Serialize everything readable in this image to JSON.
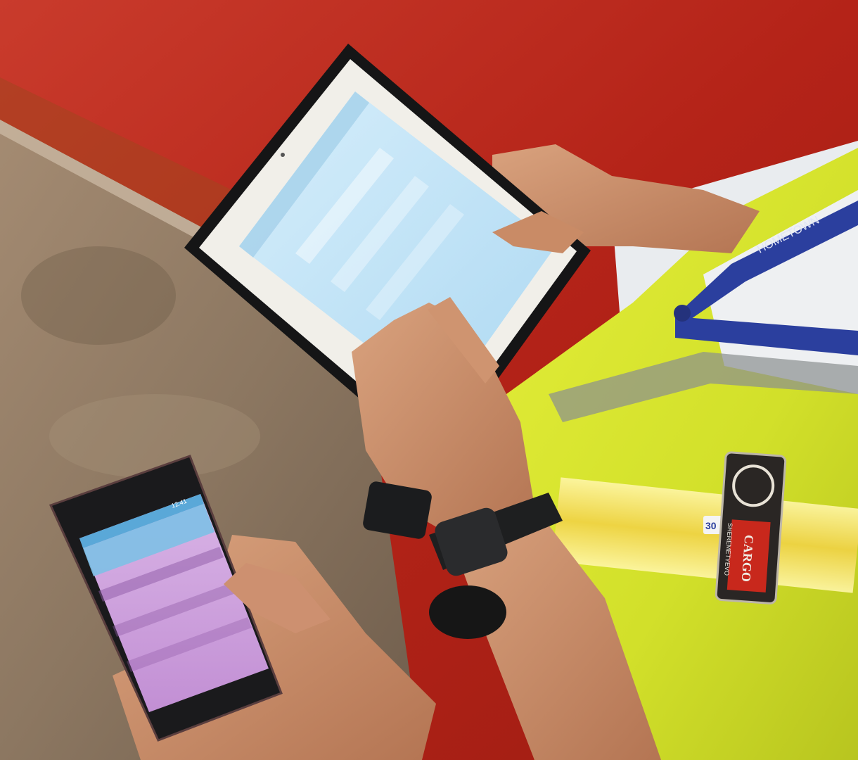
{
  "scene": {
    "description_tags": [
      "photo",
      "tablet",
      "smartphone",
      "hands",
      "hi-vis-vest",
      "cargo"
    ]
  },
  "patch": {
    "line1": "SHEREMETYEVO",
    "line2": "CARGO"
  },
  "lanyard": {
    "text": "HOMETOWN"
  },
  "sticker": {
    "text": "30"
  },
  "phone": {
    "status_time": "12:41"
  },
  "colors": {
    "wall_red": "#b8241a",
    "floor": "#8f7a63",
    "vest_yellow": "#d8e62a",
    "tablet_screen": "#bfe3f6",
    "phone_screen": "#c79ad6",
    "patch_dark": "#2a2624",
    "patch_red": "#c8281c"
  }
}
